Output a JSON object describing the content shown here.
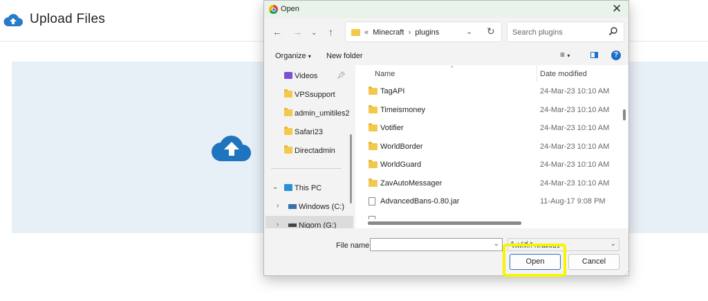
{
  "page": {
    "title": "Upload Files",
    "icons": {
      "header": "cloud-upload-icon",
      "zone": "cloud-upload-icon"
    },
    "colors": {
      "zone_bg": "#e8f0f7",
      "brand_blue": "#2a7bc7",
      "highlight": "#f5f500"
    }
  },
  "dialog": {
    "title": "Open",
    "address": {
      "prefix": "«",
      "path": [
        "Minecraft",
        "plugins"
      ]
    },
    "search_placeholder": "Search plugins",
    "toolbar": {
      "organize": "Organize",
      "new_folder": "New folder"
    },
    "nav": [
      {
        "label": "Videos",
        "type": "videos",
        "pinned": true
      },
      {
        "label": "VPSsupport",
        "type": "folder"
      },
      {
        "label": "admin_umitiles2",
        "type": "folder"
      },
      {
        "label": "Safari23",
        "type": "folder"
      },
      {
        "label": "Directadmin",
        "type": "folder"
      },
      {
        "label": "This PC",
        "type": "pc",
        "expanded": true
      },
      {
        "label": "Windows (C:)",
        "type": "drive"
      },
      {
        "label": "Nigorn (G:)",
        "type": "drive",
        "selected": true
      }
    ],
    "columns": {
      "name": "Name",
      "date": "Date modified"
    },
    "files": [
      {
        "name": "TagAPI",
        "date": "24-Mar-23 10:10 AM",
        "type": "folder"
      },
      {
        "name": "Timeismoney",
        "date": "24-Mar-23 10:10 AM",
        "type": "folder"
      },
      {
        "name": "Votifier",
        "date": "24-Mar-23 10:10 AM",
        "type": "folder"
      },
      {
        "name": "WorldBorder",
        "date": "24-Mar-23 10:10 AM",
        "type": "folder"
      },
      {
        "name": "WorldGuard",
        "date": "24-Mar-23 10:10 AM",
        "type": "folder"
      },
      {
        "name": "ZavAutoMessager",
        "date": "24-Mar-23 10:10 AM",
        "type": "folder"
      },
      {
        "name": "AdvancedBans-0.80.jar",
        "date": "11-Aug-17 9:08 PM",
        "type": "file"
      }
    ],
    "file_name_label": "File name:",
    "file_name_value": "",
    "filter_value": "ไฟล์ที่กำหนดเอง",
    "open_label": "Open",
    "cancel_label": "Cancel"
  }
}
